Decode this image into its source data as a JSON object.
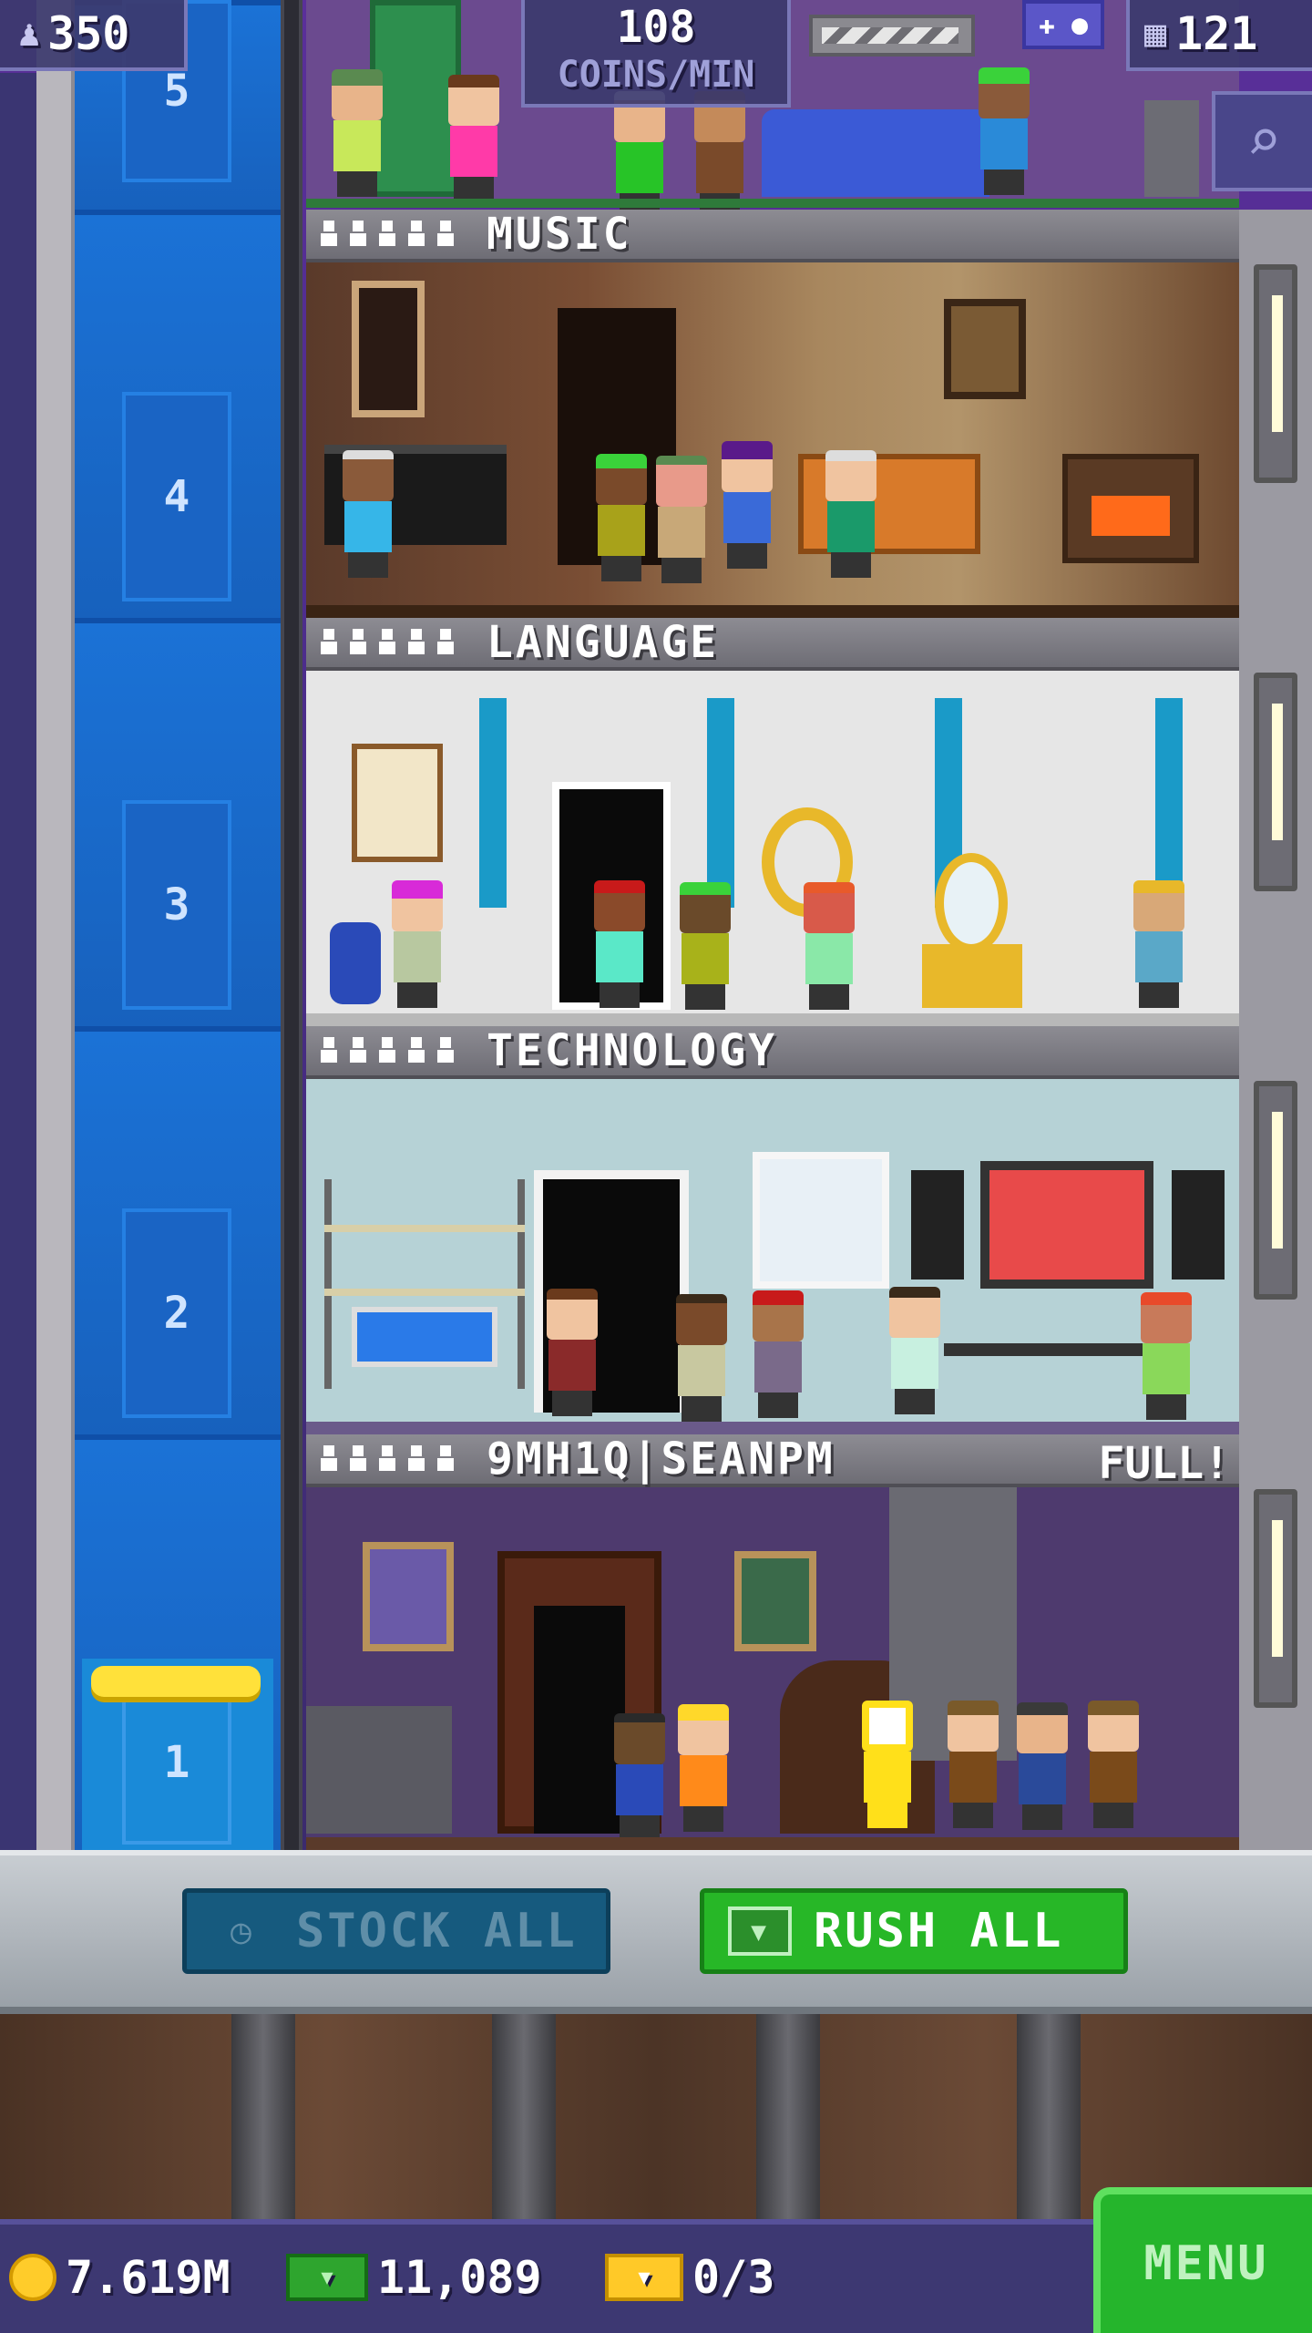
{
  "hud": {
    "population": "350",
    "coins_per_min_value": "108",
    "coins_per_min_label": "COINS/MIN",
    "floors": "121"
  },
  "shaft": {
    "floor_numbers": [
      "5",
      "4",
      "3",
      "2",
      "1"
    ]
  },
  "floors": [
    {
      "name": "MUSIC",
      "status": ""
    },
    {
      "name": "LANGUAGE",
      "status": ""
    },
    {
      "name": "TECHNOLOGY",
      "status": ""
    },
    {
      "name": "9MH1Q|SEANPM",
      "status": "FULL!"
    }
  ],
  "controls": {
    "stock_all": "STOCK ALL",
    "rush_all": "RUSH ALL"
  },
  "status": {
    "coins": "7.619M",
    "bux": "11,089",
    "tickets": "0/3"
  },
  "menu": {
    "label": "MENU"
  },
  "icons": {
    "population": "person-icon",
    "floors": "building-icon",
    "search": "magnifier-icon",
    "stock": "clock-icon",
    "rush": "bux-icon",
    "coins": "coin-icon",
    "bux": "bux-icon",
    "tickets": "ticket-icon",
    "game": "gamepad-icon"
  }
}
